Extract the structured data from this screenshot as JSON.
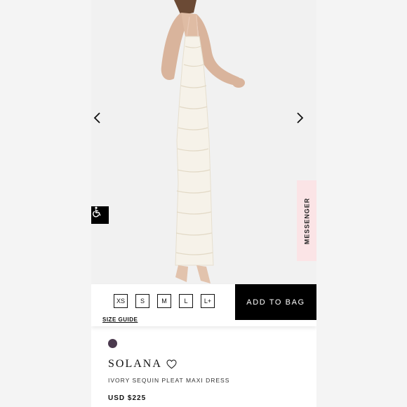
{
  "product": {
    "name": "SOLANA",
    "subtitle": "IVORY SEQUIN PLEAT MAXI DRESS",
    "price": "USD $225",
    "swatch_color": "#4b3a4e"
  },
  "sizes": [
    "XS",
    "S",
    "M",
    "L",
    "L+"
  ],
  "actions": {
    "size_guide": "SIZE GUIDE",
    "add_to_bag": "ADD TO BAG"
  },
  "messenger_label": "MESSENGER",
  "icons": {
    "prev": "chevron-left-icon",
    "next": "chevron-right-icon",
    "accessibility": "wheelchair-icon",
    "wishlist": "heart-icon"
  }
}
